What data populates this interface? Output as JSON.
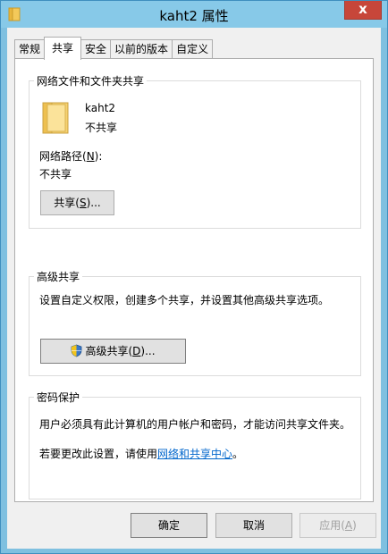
{
  "window": {
    "title": "kaht2 属性",
    "close_symbol": "x"
  },
  "tabs": [
    {
      "label": "常规"
    },
    {
      "label": "共享"
    },
    {
      "label": "安全"
    },
    {
      "label": "以前的版本"
    },
    {
      "label": "自定义"
    }
  ],
  "network_sharing": {
    "heading": "网络文件和文件夹共享",
    "folder_name": "kaht2",
    "share_status": "不共享",
    "network_path_label_pre": "网络路径(",
    "network_path_label_key": "N",
    "network_path_label_post": "):",
    "network_path_value": "不共享",
    "share_button_pre": "共享(",
    "share_button_key": "S",
    "share_button_post": ")..."
  },
  "advanced_sharing": {
    "heading": "高级共享",
    "description": "设置自定义权限，创建多个共享，并设置其他高级共享选项。",
    "button_pre": "高级共享(",
    "button_key": "D",
    "button_post": ")..."
  },
  "password_protection": {
    "heading": "密码保护",
    "description": "用户必须具有此计算机的用户帐户和密码，才能访问共享文件夹。",
    "change_pre": "若要更改此设置，请使用",
    "change_link": "网络和共享中心",
    "change_post": "。"
  },
  "footer": {
    "ok_label": "确定",
    "cancel_label": "取消",
    "apply_pre": "应用(",
    "apply_key": "A",
    "apply_post": ")"
  },
  "colors": {
    "title_bar": "#87c9e8",
    "close_button": "#c7463a",
    "link": "#0066cc"
  }
}
